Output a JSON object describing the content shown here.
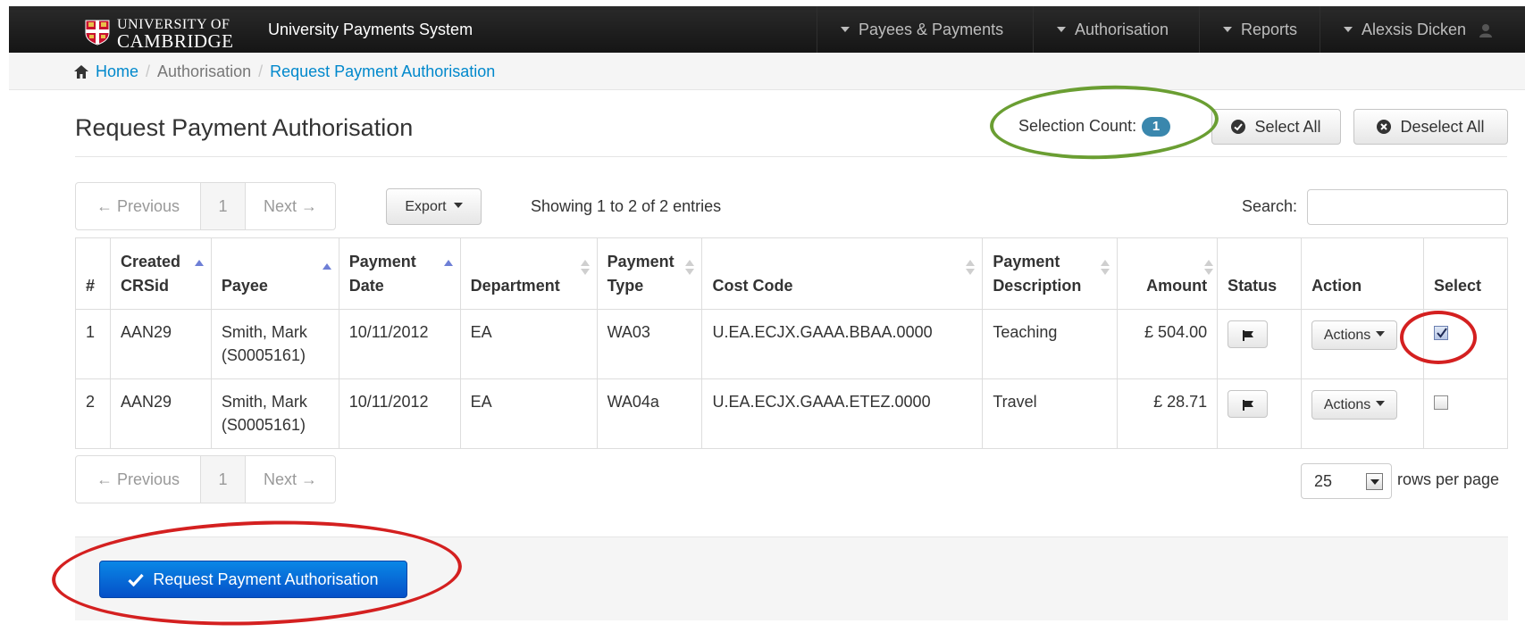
{
  "navbar": {
    "brand_line1": "UNIVERSITY OF",
    "brand_line2": "CAMBRIDGE",
    "app_name": "University Payments System",
    "menus": [
      "Payees & Payments",
      "Authorisation",
      "Reports",
      "Alexsis Dicken"
    ],
    "background": "#1a1a1a"
  },
  "breadcrumb": {
    "home": "Home",
    "section": "Authorisation",
    "current": "Request Payment Authorisation",
    "separator": "/"
  },
  "page": {
    "title": "Request Payment Authorisation",
    "selection_label": "Selection Count:",
    "selection_count": "1",
    "select_all": "Select All",
    "deselect_all": "Deselect All"
  },
  "toolbar": {
    "prev": "← Previous",
    "page": "1",
    "next": "Next →",
    "export": "Export",
    "showing": "Showing 1 to 2 of 2 entries",
    "search_label": "Search:",
    "search_value": ""
  },
  "table": {
    "headers": {
      "num": "#",
      "crsid_1": "Created",
      "crsid_2": "CRSid",
      "payee": "Payee",
      "date_1": "Payment",
      "date_2": "Date",
      "department": "Department",
      "type_1": "Payment",
      "type_2": "Type",
      "cost_code": "Cost Code",
      "desc_1": "Payment",
      "desc_2": "Description",
      "amount": "Amount",
      "status": "Status",
      "action": "Action",
      "select": "Select"
    },
    "rows": [
      {
        "num": "1",
        "crsid": "AAN29",
        "payee_name": "Smith, Mark",
        "payee_id": "(S0005161)",
        "date": "10/11/2012",
        "department": "EA",
        "type": "WA03",
        "cost_code": "U.EA.ECJX.GAAA.BBAA.0000",
        "description": "Teaching",
        "amount": "£ 504.00",
        "actions": "Actions",
        "selected": true
      },
      {
        "num": "2",
        "crsid": "AAN29",
        "payee_name": "Smith, Mark",
        "payee_id": "(S0005161)",
        "date": "10/11/2012",
        "department": "EA",
        "type": "WA04a",
        "cost_code": "U.EA.ECJX.GAAA.ETEZ.0000",
        "description": "Travel",
        "amount": "£ 28.71",
        "actions": "Actions",
        "selected": false
      }
    ]
  },
  "footer": {
    "rows_per_page_value": "25",
    "rows_per_page_label": "rows per page",
    "submit": "Request Payment Authorisation"
  },
  "colors": {
    "link": "#0088cc",
    "badge": "#3a87ad",
    "primary": "#0a6ed8",
    "annotation_green": "#6a9e32",
    "annotation_red": "#d42020"
  },
  "icons": [
    "crest-icon",
    "caret-down-icon",
    "user-icon",
    "home-icon",
    "check-circle-icon",
    "times-circle-icon",
    "sort-icon",
    "flag-icon",
    "check-icon"
  ]
}
